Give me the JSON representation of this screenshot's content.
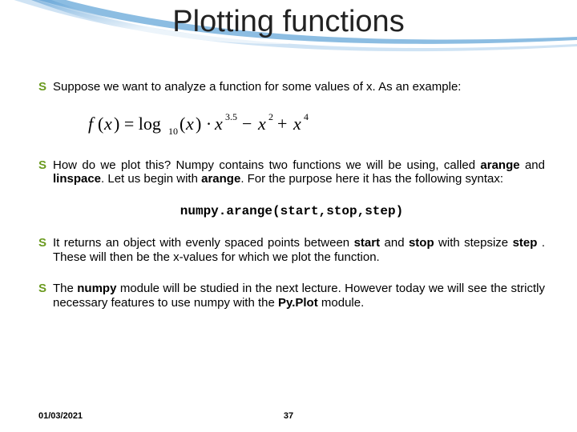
{
  "title": "Plotting functions",
  "bullets": {
    "b1": "Suppose we want to analyze a function for some values of x. As an example:",
    "b2_pre": "How do we plot this? Numpy contains two functions we will be using, called ",
    "b2_kw1": "arange",
    "b2_mid1": " and ",
    "b2_kw2": "linspace",
    "b2_mid2": ". Let us begin with ",
    "b2_kw3": "arange",
    "b2_post": ". For the purpose here it has the following syntax:",
    "code": "numpy.arange(start,stop,step)",
    "b3_pre": "It returns an object with evenly spaced points between ",
    "b3_kw1": "start",
    "b3_mid1": " and ",
    "b3_kw2": "stop",
    "b3_mid2": " with stepsize ",
    "b3_kw3": "step",
    "b3_post": " . These will then be the x-values for which we plot the function.",
    "b4_pre": "The ",
    "b4_kw1": "numpy",
    "b4_mid1": " module will be studied in the next lecture. However today we will see the strictly necessary features to use numpy with the ",
    "b4_kw2": "Py.Plot",
    "b4_post": " module."
  },
  "footer": {
    "date": "01/03/2021",
    "page": "37"
  }
}
